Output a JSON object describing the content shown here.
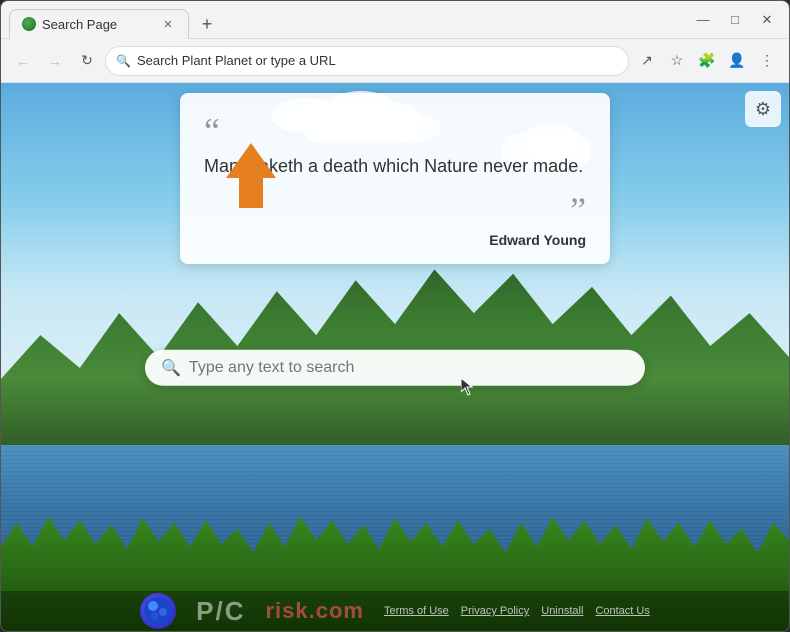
{
  "browser": {
    "tab": {
      "title": "Search Page",
      "favicon_color": "#4CAF50"
    },
    "address_bar": {
      "placeholder": "Search Plant Planet or type a URL",
      "url": "Search Plant Planet or type a URL"
    },
    "new_tab_label": "+",
    "window_controls": {
      "minimize": "—",
      "maximize": "□",
      "close": "✕"
    },
    "nav": {
      "back": "←",
      "forward": "→",
      "reload": "↻"
    }
  },
  "page": {
    "quote": {
      "open_mark": "“",
      "close_mark": "”",
      "text": "Man maketh a death which Nature never made.",
      "author": "Edward Young"
    },
    "search": {
      "placeholder": "Type any text to search"
    },
    "settings_icon": "⚙",
    "watermark": {
      "text": "P/C",
      "brand": "risk.com",
      "links": [
        "Terms of Use",
        "Privacy Policy",
        "Uninstall",
        "Contact Us"
      ]
    }
  },
  "icons": {
    "search": "🔍",
    "gear": "⚙",
    "extensions": "🧩",
    "profile": "👤",
    "share": "↗",
    "bookmark": "☆",
    "menu": "⋮"
  }
}
